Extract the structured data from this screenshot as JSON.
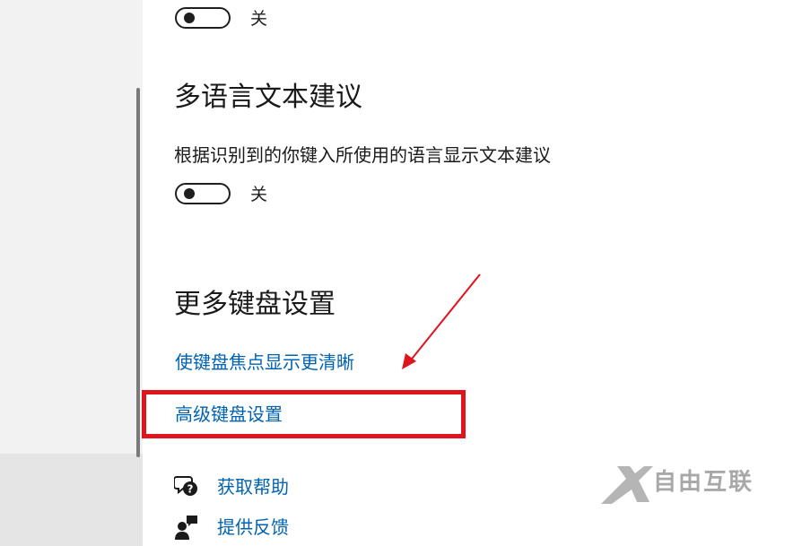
{
  "toggle_top": {
    "state_label": "关",
    "state": "off"
  },
  "multilang": {
    "heading": "多语言文本建议",
    "description": "根据识别到的你键入所使用的语言显示文本建议",
    "toggle_state_label": "关",
    "toggle_state": "off"
  },
  "more_keyboard": {
    "heading": "更多键盘设置",
    "links": [
      {
        "label": "使键盘焦点显示更清晰"
      },
      {
        "label": "高级键盘设置"
      }
    ]
  },
  "help": {
    "get_help_label": "获取帮助",
    "feedback_label": "提供反馈"
  },
  "watermark": {
    "text": "自由互联"
  },
  "colors": {
    "link": "#0063b1",
    "highlight": "#e0141c",
    "annotation_arrow": "#e0141c"
  },
  "icons": {
    "get_help": "chat-question-icon",
    "feedback": "feedback-person-icon"
  }
}
